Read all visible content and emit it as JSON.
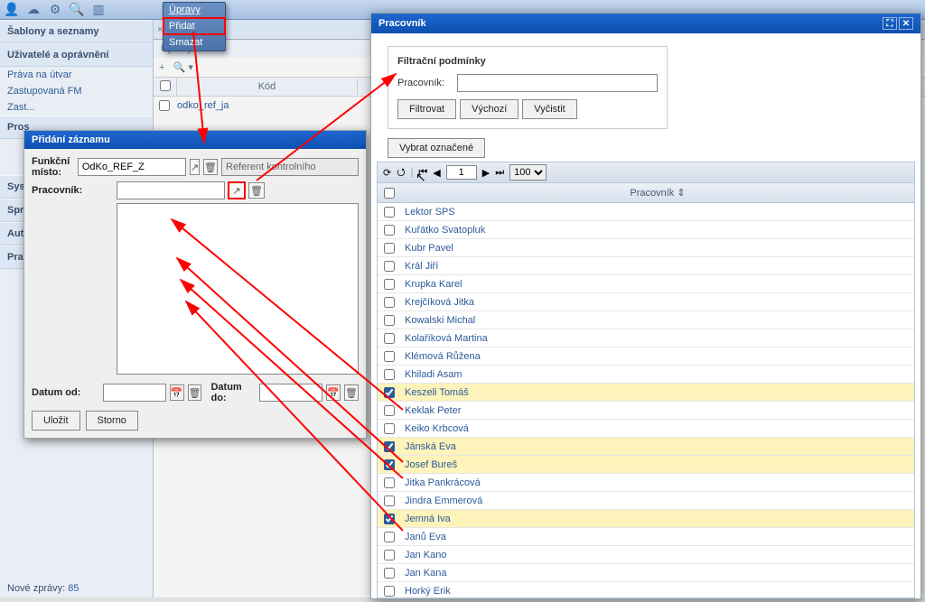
{
  "toolbar_icons": [
    "user",
    "folder",
    "gear",
    "search",
    "menu"
  ],
  "sidebar": {
    "group1": "Šablony a seznamy",
    "group2": "Uživatelé a oprávnění",
    "links": [
      "Práva na útvar",
      "Zastupovaná FM",
      "Zast..."
    ],
    "trunc": [
      "Pros",
      "Syst",
      "Spr",
      "Auto",
      "Prac"
    ],
    "footer_label": "Nové zprávy:",
    "footer_count": "85"
  },
  "bg": {
    "tab_upravy": "Úpravy",
    "th_kod": "Kód",
    "row1": "odko_ref_ja"
  },
  "upravy": {
    "item_pridat": "Přidat",
    "item_smazat": "Smazat"
  },
  "modal1": {
    "title": "Přidání záznamu",
    "label_fm": "Funkční místo:",
    "value_fm": "OdKo_REF_Z",
    "desc_fm": "Referent kontrolního",
    "label_prac": "Pracovník:",
    "label_datumod": "Datum od:",
    "label_datumdo": "Datum do:",
    "btn_save": "Uložit",
    "btn_cancel": "Storno"
  },
  "modal2": {
    "title": "Pracovník",
    "filter_heading": "Filtrační podmínky",
    "filter_label": "Pracovník:",
    "btn_filtrovat": "Filtrovat",
    "btn_vychozi": "Výchozí",
    "btn_vycistit": "Vyčistit",
    "btn_select": "Vybrat označené",
    "page_value": "1",
    "page_size": "100",
    "col_prac": "Pracovník",
    "rows": [
      {
        "name": "Lektor SPS",
        "sel": false
      },
      {
        "name": "Kuřátko Svatopluk",
        "sel": false
      },
      {
        "name": "Kubr Pavel",
        "sel": false
      },
      {
        "name": "Král Jiří",
        "sel": false
      },
      {
        "name": "Krupka Karel",
        "sel": false
      },
      {
        "name": "Krejčíková Jitka",
        "sel": false
      },
      {
        "name": "Kowalski Michal",
        "sel": false
      },
      {
        "name": "Kolaříková Martina",
        "sel": false
      },
      {
        "name": "Klémová Růžena",
        "sel": false
      },
      {
        "name": "Khiladi Asam",
        "sel": false
      },
      {
        "name": "Keszeli Tomáš",
        "sel": true
      },
      {
        "name": "Keklak Peter",
        "sel": false
      },
      {
        "name": "Keiko Krbcová",
        "sel": false
      },
      {
        "name": "Jánská Eva",
        "sel": true
      },
      {
        "name": "Josef Bureš",
        "sel": true
      },
      {
        "name": "Jitka Pankrácová",
        "sel": false
      },
      {
        "name": "Jindra Emmerová",
        "sel": false
      },
      {
        "name": "Jemná Iva",
        "sel": true
      },
      {
        "name": "Janů Eva",
        "sel": false
      },
      {
        "name": "Jan Kano",
        "sel": false
      },
      {
        "name": "Jan Kana",
        "sel": false
      },
      {
        "name": "Horký Erik",
        "sel": false
      }
    ]
  }
}
